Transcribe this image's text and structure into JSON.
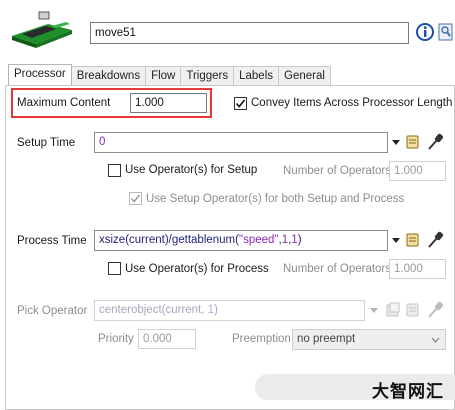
{
  "header": {
    "object_name": "move51",
    "icons": [
      "conveyor-processor-icon",
      "info-icon",
      "properties-icon"
    ]
  },
  "tabs": [
    {
      "label": "Processor",
      "active": true
    },
    {
      "label": "Breakdowns"
    },
    {
      "label": "Flow"
    },
    {
      "label": "Triggers"
    },
    {
      "label": "Labels"
    },
    {
      "label": "General"
    }
  ],
  "processor": {
    "max_content_label": "Maximum Content",
    "max_content_value": "1.000",
    "convey_label": "Convey Items Across Processor Length",
    "convey_checked": true,
    "setup_time_label": "Setup Time",
    "setup_time_value": "0",
    "use_op_setup_label": "Use Operator(s) for Setup",
    "num_operators_label": "Number of Operators",
    "num_operators_setup": "1.000",
    "use_setup_both_label": "Use Setup Operator(s) for both Setup and Process",
    "process_time_label": "Process Time",
    "process_time_fn1": "xsize(current)/gettablenum(",
    "process_time_str": "\"speed\"",
    "process_time_sep": ",",
    "process_time_n1": "1",
    "process_time_n2": "1",
    "process_time_close": ")",
    "use_op_process_label": "Use Operator(s) for Process",
    "num_operators_process": "1.000",
    "pick_operator_label": "Pick Operator",
    "pick_operator_fn": "centerobject(current, ",
    "pick_operator_num": "1",
    "pick_operator_close": ")",
    "priority_label": "Priority",
    "priority_value": "0.000",
    "preemption_label": "Preemption",
    "preemption_value": "no preempt"
  },
  "watermark": "大智网汇",
  "colors": {
    "highlight": "#e53838",
    "accent": "#1a73e8"
  }
}
